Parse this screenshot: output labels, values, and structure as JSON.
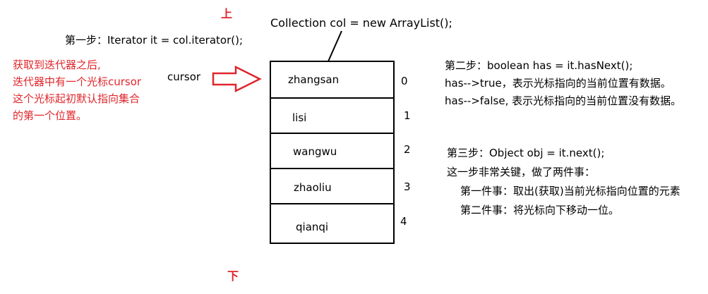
{
  "labels": {
    "top": "上",
    "bottom": "下",
    "collection_code": "Collection col = new ArrayList();",
    "cursor": "cursor"
  },
  "step1": "第一步：Iterator it = col.iterator();",
  "red_note": [
    "获取到迭代器之后,",
    "迭代器中有一个光标cursor",
    "这个光标起初默认指向集合",
    "的第一个位置。"
  ],
  "step2": [
    "第二步：boolean has = it.hasNext();",
    "has-->true，表示光标指向的当前位置有数据。",
    "has-->false, 表示光标指向的当前位置没有数据。"
  ],
  "step3": [
    "第三步：Object obj = it.next();",
    "这一步非常关键，做了两件事：",
    "第一件事：取出(获取)当前光标指向位置的元素",
    "第二件事：将光标向下移动一位。"
  ],
  "elements": [
    {
      "value": "zhangsan",
      "index": "0"
    },
    {
      "value": "lisi",
      "index": "1"
    },
    {
      "value": "wangwu",
      "index": "2"
    },
    {
      "value": "zhaoliu",
      "index": "3"
    },
    {
      "value": "qianqi",
      "index": "4"
    }
  ],
  "colors": {
    "accent_red": "#e0262b",
    "line": "#000000"
  }
}
